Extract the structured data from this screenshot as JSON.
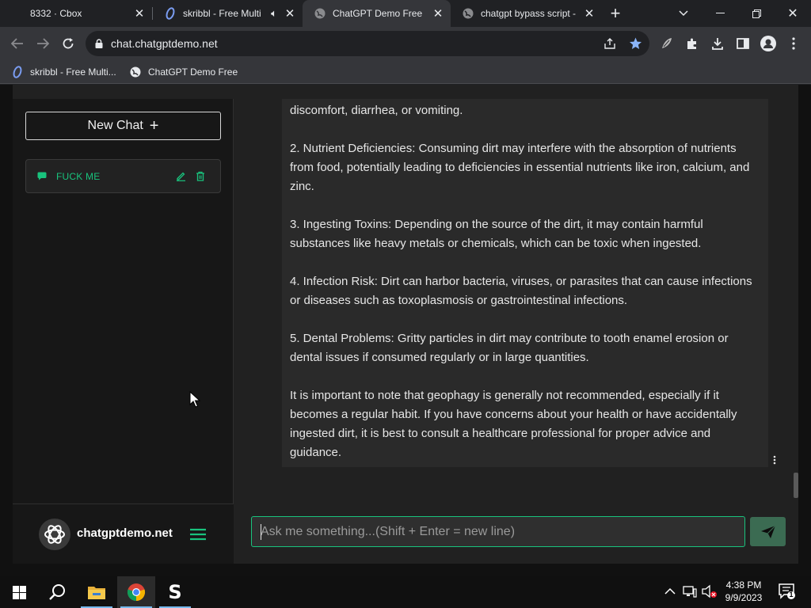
{
  "browser": {
    "tabs": [
      {
        "title": "8332 · Cbox",
        "active": false
      },
      {
        "title": "skribbl - Free Multi",
        "active": false,
        "audio": true
      },
      {
        "title": "ChatGPT Demo Free",
        "active": true
      },
      {
        "title": "chatgpt bypass script -",
        "active": false
      }
    ],
    "address": "chat.chatgptdemo.net",
    "bookmarks": [
      {
        "label": "skribbl - Free Multi..."
      },
      {
        "label": "ChatGPT Demo Free"
      }
    ]
  },
  "sidebar": {
    "new_chat_label": "New Chat",
    "conversations": [
      {
        "label": "FUCK ME"
      }
    ],
    "brand_name": "chatgptdemo.net"
  },
  "message": {
    "top_line": "discomfort, diarrhea, or vomiting.",
    "paragraphs": [
      "2. Nutrient Deficiencies: Consuming dirt may interfere with the absorption of nutrients from food, potentially leading to deficiencies in essential nutrients like iron, calcium, and zinc.",
      "3. Ingesting Toxins: Depending on the source of the dirt, it may contain harmful substances like heavy metals or chemicals, which can be toxic when ingested.",
      "4. Infection Risk: Dirt can harbor bacteria, viruses, or parasites that can cause infections or diseases such as toxoplasmosis or gastrointestinal infections.",
      "5. Dental Problems: Gritty particles in dirt may contribute to tooth enamel erosion or dental issues if consumed regularly or in large quantities.",
      "It is important to note that geophagy is generally not recommended, especially if it becomes a regular habit. If you have concerns about your health or have accidentally ingested dirt, it is best to consult a healthcare professional for proper advice and guidance."
    ]
  },
  "composer": {
    "placeholder": "Ask me something...(Shift + Enter = new line)",
    "value": ""
  },
  "taskbar": {
    "time": "4:38 PM",
    "date": "9/9/2023",
    "notification_count": "1"
  },
  "colors": {
    "accent": "#19c37d",
    "send_button": "#3b6b52",
    "sidebar_bg": "#171717",
    "chat_bg": "#212121",
    "message_bg": "#2a2a2a"
  }
}
